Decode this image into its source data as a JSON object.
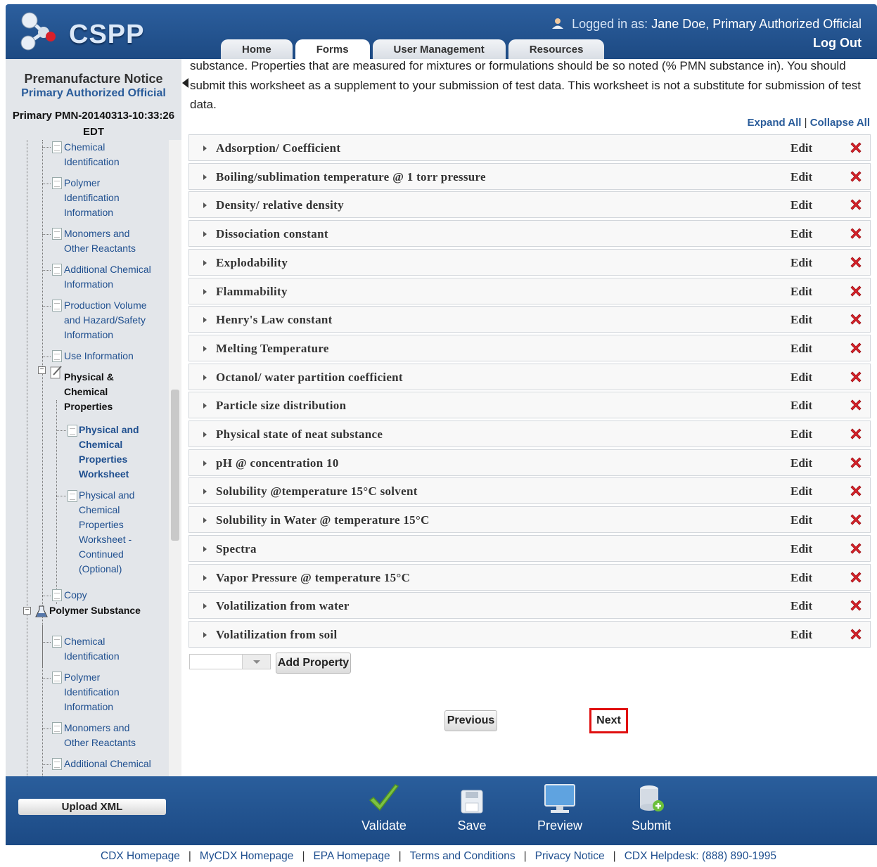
{
  "header": {
    "logo_text": "CSPP",
    "logged_in_prefix": "Logged in as:",
    "logged_in_user": "Jane Doe, Primary Authorized Official",
    "logout_label": "Log Out",
    "tabs": [
      {
        "label": "Home",
        "active": false
      },
      {
        "label": "Forms",
        "active": true
      },
      {
        "label": "User Management",
        "active": false
      },
      {
        "label": "Resources",
        "active": false
      }
    ]
  },
  "sidebar": {
    "title": "Premanufacture Notice",
    "subtitle": "Primary Authorized Official",
    "pmn_id": "Primary PMN-20140313-10:33:26 EDT",
    "items": [
      {
        "label": "Chemical Identification"
      },
      {
        "label": "Polymer Identification Information"
      },
      {
        "label": "Monomers and Other Reactants"
      },
      {
        "label": "Additional Chemical Information"
      },
      {
        "label": "Production Volume and Hazard/Safety Information"
      },
      {
        "label": "Use Information"
      },
      {
        "label": "Physical & Chemical Properties"
      },
      {
        "label": "Physical and Chemical Properties Worksheet"
      },
      {
        "label": "Physical and Chemical Properties Worksheet - Continued (Optional)"
      },
      {
        "label": "Copy"
      },
      {
        "label": "Polymer Substance"
      },
      {
        "label": "Chemical Identification"
      },
      {
        "label": "Polymer Identification Information"
      },
      {
        "label": "Monomers and Other Reactants"
      },
      {
        "label": "Additional Chemical"
      }
    ]
  },
  "main": {
    "intro_text": "substance. Properties that are measured for mixtures or formulations should be so noted (% PMN substance in). You should submit this worksheet as a supplement to your submission of test data. This worksheet is not a substitute for submission of test data.",
    "expand_all": "Expand All",
    "collapse_all": "Collapse All",
    "divider": "|",
    "edit_label": "Edit",
    "properties": [
      "Adsorption/ Coefficient",
      "Boiling/sublimation temperature @ 1 torr pressure",
      "Density/ relative density",
      "Dissociation constant",
      "Explodability",
      "Flammability",
      "Henry's Law constant",
      "Melting Temperature",
      "Octanol/ water partition coefficient",
      "Particle size distribution",
      "Physical state of neat substance",
      "pH @ concentration 10",
      "Solubility @temperature 15°C solvent",
      "Solubility in Water @ temperature 15°C",
      "Spectra",
      "Vapor Pressure @ temperature 15°C",
      "Volatilization from water",
      "Volatilization from soil"
    ],
    "add_property_label": "Add Property",
    "previous_label": "Previous",
    "next_label": "Next"
  },
  "footer": {
    "upload_label": "Upload XML",
    "actions": [
      "Validate",
      "Save",
      "Preview",
      "Submit"
    ],
    "links": [
      "CDX Homepage",
      "MyCDX Homepage",
      "EPA Homepage",
      "Terms and Conditions",
      "Privacy Notice",
      "CDX Helpdesk: (888) 890-1995"
    ],
    "link_separator": "|"
  },
  "colors": {
    "brand_blue": "#2c5f9e",
    "link_blue": "#2a5c9a",
    "delete_red": "#d8222a",
    "highlight_red": "#e01010"
  }
}
